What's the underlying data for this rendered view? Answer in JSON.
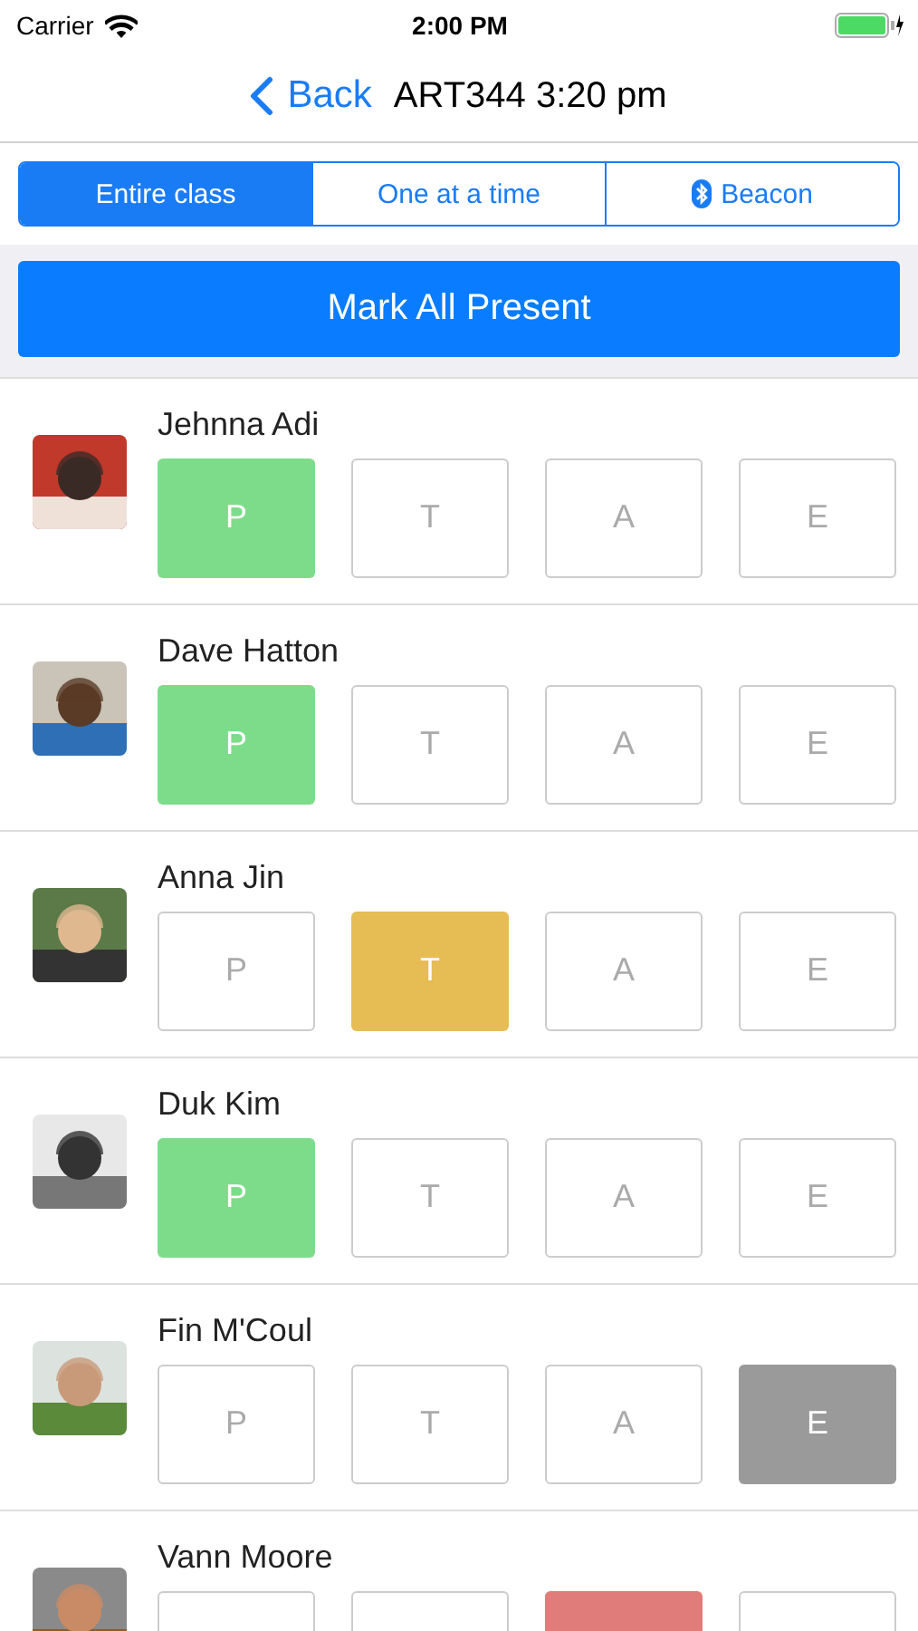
{
  "status_bar": {
    "carrier": "Carrier",
    "time": "2:00 PM"
  },
  "nav": {
    "back": "Back",
    "title": "ART344 3:20 pm"
  },
  "segments": [
    {
      "label": "Entire class",
      "selected": true,
      "kind": "text"
    },
    {
      "label": "One at a time",
      "selected": false,
      "kind": "text"
    },
    {
      "label": "Beacon",
      "selected": false,
      "kind": "bluetooth"
    }
  ],
  "mark_all_button": "Mark All Present",
  "students": [
    {
      "name": "Jehnna Adi",
      "options": [
        {
          "label": "P",
          "selected": true,
          "color": "#7ddc8a"
        },
        {
          "label": "T",
          "selected": false
        },
        {
          "label": "A",
          "selected": false
        },
        {
          "label": "E",
          "selected": false
        }
      ]
    },
    {
      "name": "Dave Hatton",
      "options": [
        {
          "label": "P",
          "selected": true,
          "color": "#7ddc8a"
        },
        {
          "label": "T",
          "selected": false
        },
        {
          "label": "A",
          "selected": false
        },
        {
          "label": "E",
          "selected": false
        }
      ]
    },
    {
      "name": "Anna Jin",
      "options": [
        {
          "label": "P",
          "selected": false
        },
        {
          "label": "T",
          "selected": true,
          "color": "#e6bc55"
        },
        {
          "label": "A",
          "selected": false
        },
        {
          "label": "E",
          "selected": false
        }
      ]
    },
    {
      "name": "Duk Kim",
      "options": [
        {
          "label": "P",
          "selected": true,
          "color": "#7ddc8a"
        },
        {
          "label": "T",
          "selected": false
        },
        {
          "label": "A",
          "selected": false
        },
        {
          "label": "E",
          "selected": false
        }
      ]
    },
    {
      "name": "Fin M'Coul",
      "options": [
        {
          "label": "P",
          "selected": false
        },
        {
          "label": "T",
          "selected": false
        },
        {
          "label": "A",
          "selected": false
        },
        {
          "label": "E",
          "selected": true,
          "color": "#9a9a9a"
        }
      ]
    },
    {
      "name": "Vann Moore",
      "options": [
        {
          "selected": false
        },
        {
          "selected": false
        },
        {
          "selected": true,
          "color": "#e07c7a"
        },
        {
          "selected": false
        }
      ]
    }
  ]
}
